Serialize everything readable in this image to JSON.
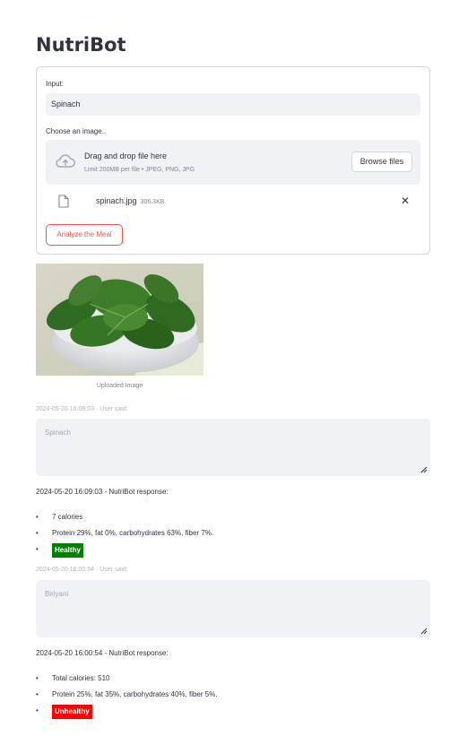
{
  "app": {
    "title": "NutriBot"
  },
  "form": {
    "input_label": "Input:",
    "input_value": "Spinach",
    "uploader_label": "Choose an image..",
    "dropzone_main": "Drag and drop file here",
    "dropzone_sub": "Limit 200MB per file • JPEG, PNG, JPG",
    "browse_label": "Browse files",
    "file_name": "spinach.jpg",
    "file_size": "306.3KB",
    "analyze_label": "Analyze the Meal"
  },
  "image": {
    "caption": "Uploaded Image"
  },
  "history": [
    {
      "user_meta": "2024-05-20 16:09:03 · User said:",
      "user_text": "Spinach",
      "bot_meta": "2024-05-20 16:09:03 - NutriBot response:",
      "bullets": [
        "7 calories",
        "Protein 29%, fat 0%, carbohydrates 63%, fiber 7%."
      ],
      "verdict": "Healthy",
      "verdict_color": "#008000"
    },
    {
      "user_meta": "2024-05-20 16:00:54 · User said:",
      "user_text": "Biriyani",
      "bot_meta": "2024-05-20 16:00:54 - NutriBot response:",
      "bullets": [
        "Total calories: 510",
        "Protein 25%, fat 35%, carbohydrates 40%, fiber 5%."
      ],
      "verdict": "Unhealthy",
      "verdict_color": "#ff0000"
    }
  ]
}
